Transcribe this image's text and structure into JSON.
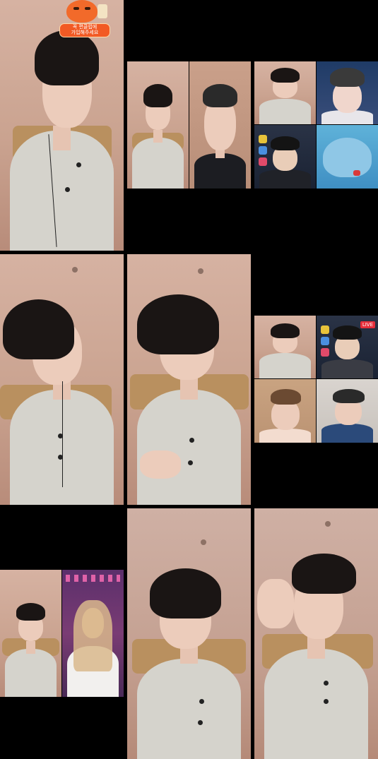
{
  "badge": {
    "line1": "꼭 편클럽에",
    "line2": "가입해주세요",
    "mascot_icon": "orange-mascot-icon",
    "cup_icon": "bubble-tea-icon"
  },
  "live_tag": "LIVE",
  "colors": {
    "background": "#000000",
    "badge_orange": "#f25a24",
    "live_red": "#e52d3a"
  }
}
